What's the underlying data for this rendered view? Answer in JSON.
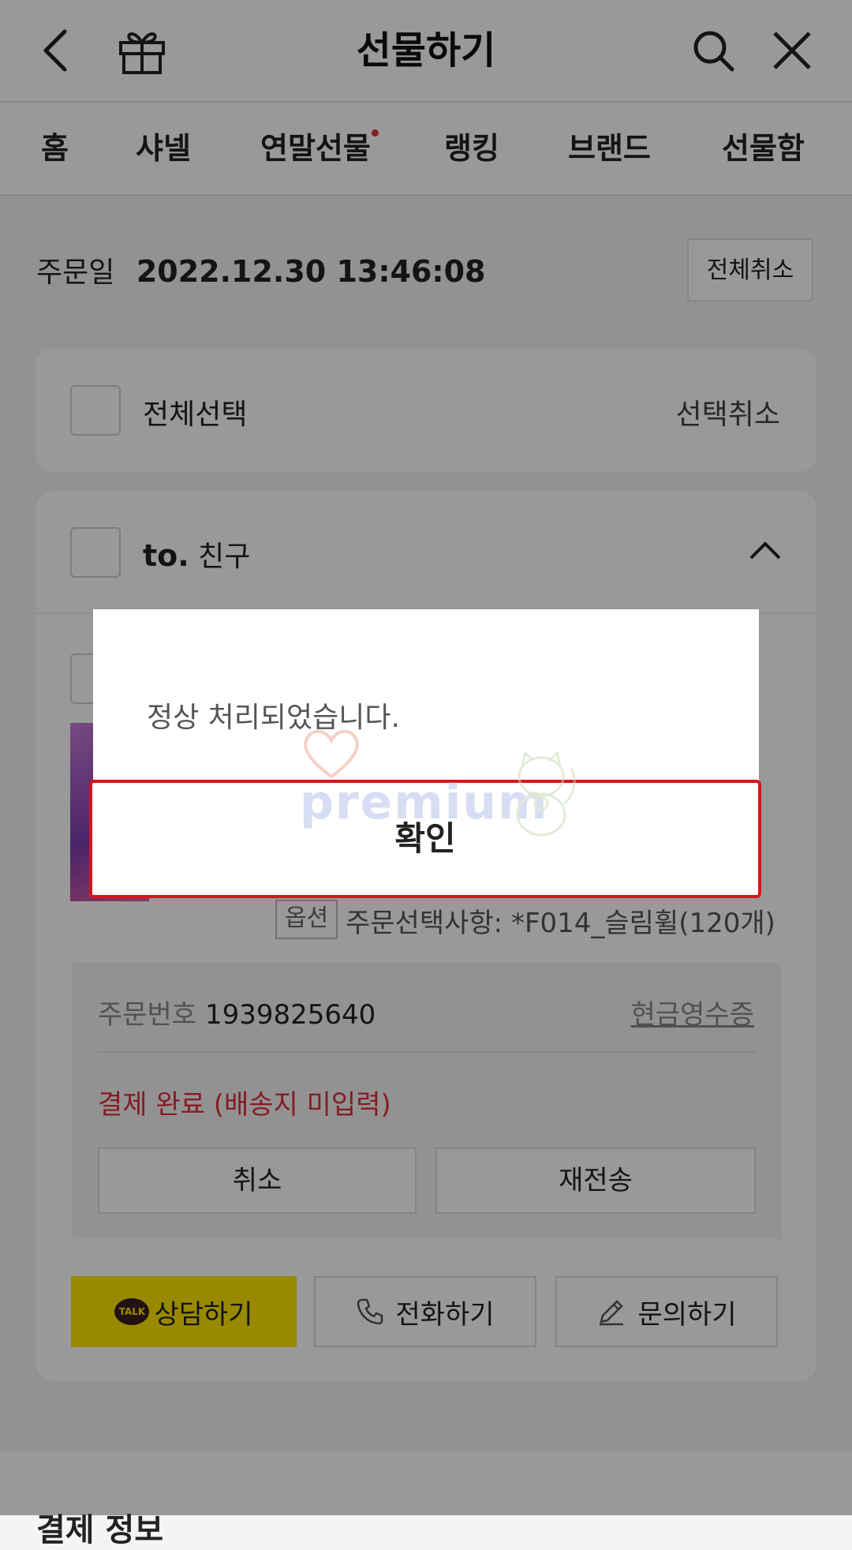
{
  "header": {
    "title": "선물하기"
  },
  "tabs": [
    {
      "label": "홈"
    },
    {
      "label": "샤넬"
    },
    {
      "label": "연말선물",
      "has_dot": true
    },
    {
      "label": "랭킹"
    },
    {
      "label": "브랜드"
    },
    {
      "label": "선물함"
    }
  ],
  "order": {
    "date_label": "주문일",
    "date_value": "2022.12.30  13:46:08",
    "cancel_all_label": "전체취소"
  },
  "select_card": {
    "select_all_label": "전체선택",
    "deselect_label": "선택취소"
  },
  "recipient": {
    "prefix": "to.",
    "name": "친구"
  },
  "item": {
    "option_badge": "옵션",
    "option_text": "주문선택사항: *F014_슬림휠(120개)"
  },
  "order_info": {
    "number_label": "주문번호",
    "number_value": "1939825640",
    "cash_receipt_label": "현금영수증",
    "status_text": "결제 완료 (배송지 미입력)",
    "cancel_label": "취소",
    "resend_label": "재전송"
  },
  "contact": {
    "chat_label": "상담하기",
    "chat_badge": "TALK",
    "call_label": "전화하기",
    "inquiry_label": "문의하기"
  },
  "payment_section": {
    "title": "결제 정보"
  },
  "modal": {
    "message": "정상 처리되었습니다.",
    "confirm_label": "확인"
  },
  "watermark": {
    "text": "premium"
  },
  "colors": {
    "status_red": "#e0303a",
    "kakao_yellow": "#fee500",
    "confirm_border": "#d9141a"
  }
}
